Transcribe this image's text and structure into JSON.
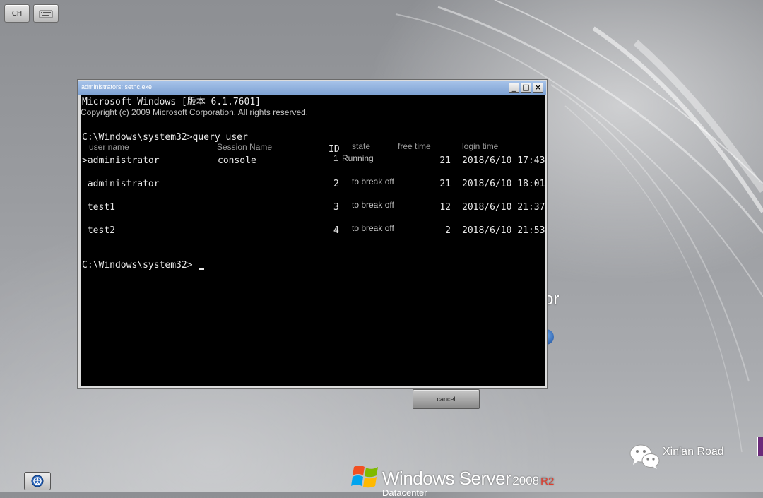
{
  "top_buttons": {
    "language_label": "CH"
  },
  "background": {
    "partial_text": "or"
  },
  "cmd_window": {
    "title": "administrators: sethc.exe",
    "controls": {
      "minimize": "_",
      "maximize": "□",
      "close": "×"
    },
    "banner_line1": "Microsoft Windows [版本 6.1.7601]",
    "banner_line2": "Copyright (c) 2009 Microsoft Corporation. All rights reserved.",
    "command_prompt": "C:\\Windows\\system32>query user",
    "headers": {
      "user_name": "user name",
      "session_name": "Session Name",
      "id": "ID",
      "state": "state",
      "free_time": "free time",
      "login_time": "login time"
    },
    "sessions": [
      {
        "user": ">administrator",
        "session": "console",
        "id": "1",
        "state": "Running",
        "idle": "21",
        "login": "2018/6/10 17:43"
      },
      {
        "user": " administrator",
        "session": "",
        "id": "2",
        "state": "to break off",
        "idle": "21",
        "login": "2018/6/10 18:01"
      },
      {
        "user": " test1",
        "session": "",
        "id": "3",
        "state": "to break off",
        "idle": "12",
        "login": "2018/6/10 21:37"
      },
      {
        "user": " test2",
        "session": "",
        "id": "4",
        "state": "to break off",
        "idle": "2",
        "login": "2018/6/10 21:53"
      }
    ],
    "final_prompt": "C:\\Windows\\system32>"
  },
  "cancel_button": {
    "label": "cancel"
  },
  "watermark": {
    "text": "Xin'an Road"
  },
  "branding": {
    "name": "Windows Server",
    "version": "2008",
    "release": "R2",
    "edition": "Datacenter",
    "colors": {
      "flag_red": "#f25022",
      "flag_green": "#7fba00",
      "flag_blue": "#00a4ef",
      "flag_yellow": "#ffb900",
      "r2": "#e23c2c"
    }
  },
  "icons": [
    "keyboard-icon",
    "ease-of-access-icon",
    "wechat-icon",
    "windows-flag-icon"
  ]
}
